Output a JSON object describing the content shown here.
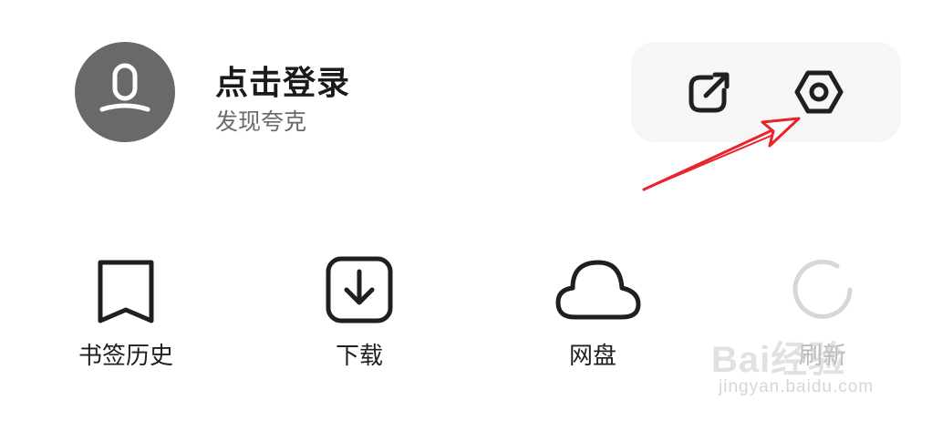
{
  "profile": {
    "avatar_icon": "user-silhouette-icon",
    "title": "点击登录",
    "subtitle": "发现夸克"
  },
  "actions": {
    "share_icon": "share-export-icon",
    "settings_icon": "settings-hexagon-icon"
  },
  "annotation": {
    "color": "#e8232a"
  },
  "shortcuts": [
    {
      "icon": "bookmark-icon",
      "label": "书签历史"
    },
    {
      "icon": "download-icon",
      "label": "下载"
    },
    {
      "icon": "cloud-icon",
      "label": "网盘"
    },
    {
      "icon": "refresh-icon",
      "label": "刷新"
    }
  ],
  "watermark": {
    "brand": "Bai经验",
    "url": "jingyan.baidu.com"
  }
}
